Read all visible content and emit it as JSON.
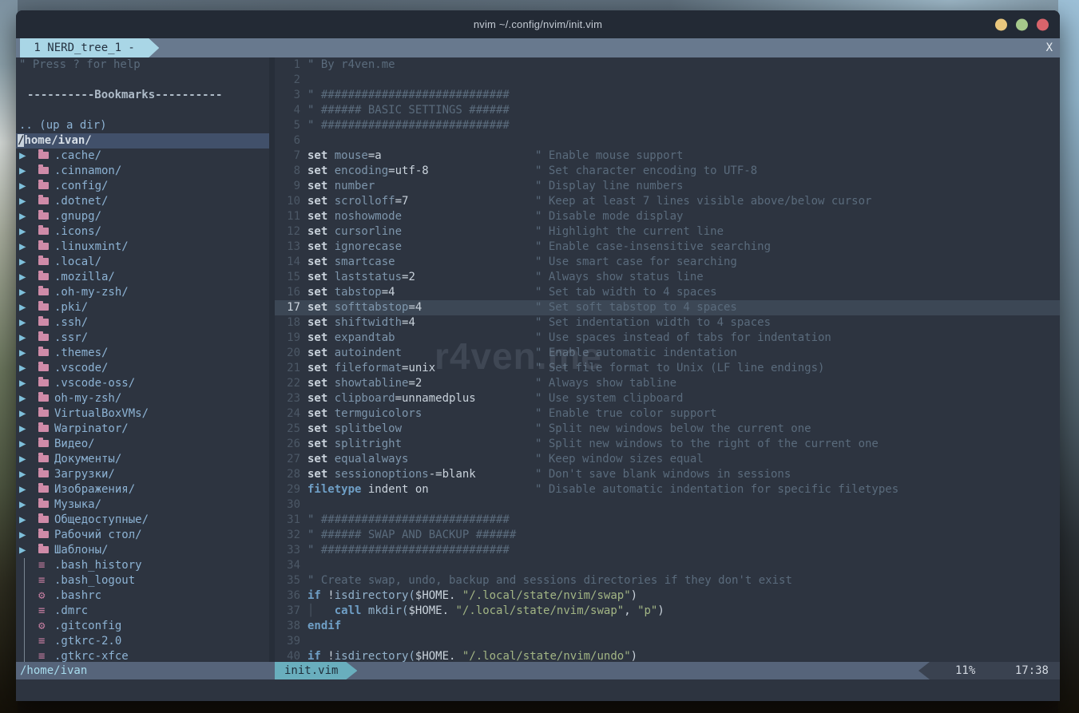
{
  "window": {
    "title": "nvim ~/.config/nvim/init.vim"
  },
  "titlebar_controls": {
    "buttons": [
      {
        "name": "minimize-button",
        "color": "#e9c77d"
      },
      {
        "name": "maximize-button",
        "color": "#a6c98b"
      },
      {
        "name": "close-button",
        "color": "#d8646b"
      }
    ]
  },
  "tabline": {
    "tab_label": " 1 NERD_tree_1 - ",
    "close_label": "X"
  },
  "nerdtree": {
    "statusline": "/home/ivan",
    "rows": [
      {
        "type": "help",
        "text": "\" Press ? for help"
      },
      {
        "type": "blank",
        "text": ""
      },
      {
        "type": "title",
        "text": "----------Bookmarks----------"
      },
      {
        "type": "blank",
        "text": ""
      },
      {
        "type": "updir",
        "text": ".. (up a dir)"
      },
      {
        "type": "root",
        "cursor_char": "/",
        "text": "home/ivan/"
      },
      {
        "type": "dir",
        "name": ".cache/"
      },
      {
        "type": "dir",
        "name": ".cinnamon/"
      },
      {
        "type": "dir",
        "name": ".config/"
      },
      {
        "type": "dir",
        "name": ".dotnet/"
      },
      {
        "type": "dir",
        "name": ".gnupg/"
      },
      {
        "type": "dir",
        "name": ".icons/"
      },
      {
        "type": "dir",
        "name": ".linuxmint/"
      },
      {
        "type": "dir",
        "name": ".local/"
      },
      {
        "type": "dir",
        "name": ".mozilla/"
      },
      {
        "type": "dir",
        "name": ".oh-my-zsh/"
      },
      {
        "type": "dir",
        "name": ".pki/"
      },
      {
        "type": "dir",
        "name": ".ssh/"
      },
      {
        "type": "dir",
        "name": ".ssr/"
      },
      {
        "type": "dir",
        "name": ".themes/"
      },
      {
        "type": "dir",
        "name": ".vscode/"
      },
      {
        "type": "dir",
        "name": ".vscode-oss/"
      },
      {
        "type": "dir",
        "name": "oh-my-zsh/"
      },
      {
        "type": "dir",
        "name": "VirtualBoxVMs/"
      },
      {
        "type": "dir",
        "name": "Warpinator/"
      },
      {
        "type": "dir",
        "name": "Видео/"
      },
      {
        "type": "dir",
        "name": "Документы/"
      },
      {
        "type": "dir",
        "name": "Загрузки/"
      },
      {
        "type": "dir",
        "name": "Изображения/"
      },
      {
        "type": "dir",
        "name": "Музыка/"
      },
      {
        "type": "dir",
        "name": "Общедоступные/"
      },
      {
        "type": "dir",
        "name": "Рабочий стол/"
      },
      {
        "type": "dir",
        "name": "Шаблоны/"
      },
      {
        "type": "file",
        "icon": "lines",
        "name": ".bash_history"
      },
      {
        "type": "file",
        "icon": "lines",
        "name": ".bash_logout"
      },
      {
        "type": "file",
        "icon": "gear",
        "name": ".bashrc"
      },
      {
        "type": "file",
        "icon": "lines",
        "name": ".dmrc"
      },
      {
        "type": "file",
        "icon": "gear",
        "name": ".gitconfig"
      },
      {
        "type": "file",
        "icon": "lines",
        "name": ".gtkrc-2.0"
      },
      {
        "type": "file",
        "icon": "lines",
        "name": ".gtkrc-xfce"
      }
    ]
  },
  "editor": {
    "cursor_line": 17,
    "lines": [
      {
        "num": 1,
        "segs": [
          [
            "cmt",
            "\" By r4ven.me"
          ]
        ]
      },
      {
        "num": 2,
        "segs": []
      },
      {
        "num": 3,
        "segs": [
          [
            "cmt",
            "\" ############################"
          ]
        ]
      },
      {
        "num": 4,
        "segs": [
          [
            "cmt",
            "\" ###### BASIC SETTINGS ######"
          ]
        ]
      },
      {
        "num": 5,
        "segs": [
          [
            "cmt",
            "\" ############################"
          ]
        ]
      },
      {
        "num": 6,
        "segs": []
      },
      {
        "num": 7,
        "segs": [
          [
            "kw",
            "set "
          ],
          [
            "opt",
            "mouse"
          ],
          [
            "val",
            "=a"
          ]
        ],
        "cmt": "\" Enable mouse support"
      },
      {
        "num": 8,
        "segs": [
          [
            "kw",
            "set "
          ],
          [
            "opt",
            "encoding"
          ],
          [
            "val",
            "=utf-8"
          ]
        ],
        "cmt": "\" Set character encoding to UTF-8"
      },
      {
        "num": 9,
        "segs": [
          [
            "kw",
            "set "
          ],
          [
            "opt",
            "number"
          ]
        ],
        "cmt": "\" Display line numbers"
      },
      {
        "num": 10,
        "segs": [
          [
            "kw",
            "set "
          ],
          [
            "opt",
            "scrolloff"
          ],
          [
            "val",
            "=7"
          ]
        ],
        "cmt": "\" Keep at least 7 lines visible above/below cursor"
      },
      {
        "num": 11,
        "segs": [
          [
            "kw",
            "set "
          ],
          [
            "opt",
            "noshowmode"
          ]
        ],
        "cmt": "\" Disable mode display"
      },
      {
        "num": 12,
        "segs": [
          [
            "kw",
            "set "
          ],
          [
            "opt",
            "cursorline"
          ]
        ],
        "cmt": "\" Highlight the current line"
      },
      {
        "num": 13,
        "segs": [
          [
            "kw",
            "set "
          ],
          [
            "opt",
            "ignorecase"
          ]
        ],
        "cmt": "\" Enable case-insensitive searching"
      },
      {
        "num": 14,
        "segs": [
          [
            "kw",
            "set "
          ],
          [
            "opt",
            "smartcase"
          ]
        ],
        "cmt": "\" Use smart case for searching"
      },
      {
        "num": 15,
        "segs": [
          [
            "kw",
            "set "
          ],
          [
            "opt",
            "laststatus"
          ],
          [
            "val",
            "=2"
          ]
        ],
        "cmt": "\" Always show status line"
      },
      {
        "num": 16,
        "segs": [
          [
            "kw",
            "set "
          ],
          [
            "opt",
            "tabstop"
          ],
          [
            "val",
            "=4"
          ]
        ],
        "cmt": "\" Set tab width to 4 spaces"
      },
      {
        "num": 17,
        "segs": [
          [
            "kw",
            "set "
          ],
          [
            "opt",
            "softtabstop"
          ],
          [
            "val",
            "=4"
          ]
        ],
        "cmt": "\" Set soft tabstop to 4 spaces"
      },
      {
        "num": 18,
        "segs": [
          [
            "kw",
            "set "
          ],
          [
            "opt",
            "shiftwidth"
          ],
          [
            "val",
            "=4"
          ]
        ],
        "cmt": "\" Set indentation width to 4 spaces"
      },
      {
        "num": 19,
        "segs": [
          [
            "kw",
            "set "
          ],
          [
            "opt",
            "expandtab"
          ]
        ],
        "cmt": "\" Use spaces instead of tabs for indentation"
      },
      {
        "num": 20,
        "segs": [
          [
            "kw",
            "set "
          ],
          [
            "opt",
            "autoindent"
          ]
        ],
        "cmt": "\" Enable automatic indentation"
      },
      {
        "num": 21,
        "segs": [
          [
            "kw",
            "set "
          ],
          [
            "opt",
            "fileformat"
          ],
          [
            "val",
            "=unix"
          ]
        ],
        "cmt": "\" Set file format to Unix (LF line endings)"
      },
      {
        "num": 22,
        "segs": [
          [
            "kw",
            "set "
          ],
          [
            "opt",
            "showtabline"
          ],
          [
            "val",
            "=2"
          ]
        ],
        "cmt": "\" Always show tabline"
      },
      {
        "num": 23,
        "segs": [
          [
            "kw",
            "set "
          ],
          [
            "opt",
            "clipboard"
          ],
          [
            "val",
            "=unnamedplus"
          ]
        ],
        "cmt": "\" Use system clipboard"
      },
      {
        "num": 24,
        "segs": [
          [
            "kw",
            "set "
          ],
          [
            "opt",
            "termguicolors"
          ]
        ],
        "cmt": "\" Enable true color support"
      },
      {
        "num": 25,
        "segs": [
          [
            "kw",
            "set "
          ],
          [
            "opt",
            "splitbelow"
          ]
        ],
        "cmt": "\" Split new windows below the current one"
      },
      {
        "num": 26,
        "segs": [
          [
            "kw",
            "set "
          ],
          [
            "opt",
            "splitright"
          ]
        ],
        "cmt": "\" Split new windows to the right of the current one"
      },
      {
        "num": 27,
        "segs": [
          [
            "kw",
            "set "
          ],
          [
            "opt",
            "equalalways"
          ]
        ],
        "cmt": "\" Keep window sizes equal"
      },
      {
        "num": 28,
        "segs": [
          [
            "kw",
            "set "
          ],
          [
            "opt",
            "sessionoptions"
          ],
          [
            "val",
            "-=blank"
          ]
        ],
        "cmt": "\" Don't save blank windows in sessions"
      },
      {
        "num": 29,
        "segs": [
          [
            "stmt",
            "filetype "
          ],
          [
            "plain",
            "indent on"
          ]
        ],
        "cmt": "\" Disable automatic indentation for specific filetypes"
      },
      {
        "num": 30,
        "segs": []
      },
      {
        "num": 31,
        "segs": [
          [
            "cmt",
            "\" ############################"
          ]
        ]
      },
      {
        "num": 32,
        "segs": [
          [
            "cmt",
            "\" ###### SWAP AND BACKUP ######"
          ]
        ]
      },
      {
        "num": 33,
        "segs": [
          [
            "cmt",
            "\" ############################"
          ]
        ]
      },
      {
        "num": 34,
        "segs": []
      },
      {
        "num": 35,
        "segs": [
          [
            "cmt",
            "\" Create swap, undo, backup and sessions directories if they don't exist"
          ]
        ]
      },
      {
        "num": 36,
        "segs": [
          [
            "stmt",
            "if "
          ],
          [
            "plain",
            "!"
          ],
          [
            "fn",
            "isdirectory("
          ],
          [
            "plain",
            "$HOME. "
          ],
          [
            "str",
            "\"/.local/state/nvim/swap\""
          ],
          [
            "plain",
            ")"
          ]
        ]
      },
      {
        "num": 37,
        "segs": [
          [
            "guide",
            "│"
          ],
          [
            "plain",
            "   "
          ],
          [
            "stmt",
            "call "
          ],
          [
            "fn",
            "mkdir("
          ],
          [
            "plain",
            "$HOME. "
          ],
          [
            "str",
            "\"/.local/state/nvim/swap\""
          ],
          [
            "plain",
            ", "
          ],
          [
            "str",
            "\"p\""
          ],
          [
            "plain",
            ")"
          ]
        ]
      },
      {
        "num": 38,
        "segs": [
          [
            "stmt",
            "endif"
          ]
        ]
      },
      {
        "num": 39,
        "segs": []
      },
      {
        "num": 40,
        "segs": [
          [
            "stmt",
            "if "
          ],
          [
            "plain",
            "!"
          ],
          [
            "fn",
            "isdirectory("
          ],
          [
            "plain",
            "$HOME. "
          ],
          [
            "str",
            "\"/.local/state/nvim/undo\""
          ],
          [
            "plain",
            ")"
          ]
        ]
      }
    ]
  },
  "statusline": {
    "file": "init.vim",
    "percent": "11%",
    "time": "17:38"
  },
  "watermark": "r4ven.me",
  "colors": {
    "terminal_bg": "#2d3440",
    "titlebar_bg": "#232a35",
    "tabline_bg": "#68798e",
    "tab_active_bg": "#a9d6e6",
    "statusline_bg": "#56647a",
    "statusline_file_bg": "#69aebd",
    "statusline_right_bg": "#3a4250",
    "cursorline_bg": "#3c4755",
    "tree_root_bg": "#41506a",
    "tree_arrow": "#7fc0db",
    "tree_icon_pink": "#cf8ba8",
    "comment": "#5a6b7c",
    "string_green": "#a2b584",
    "statement_blue": "#6f9fc6"
  }
}
